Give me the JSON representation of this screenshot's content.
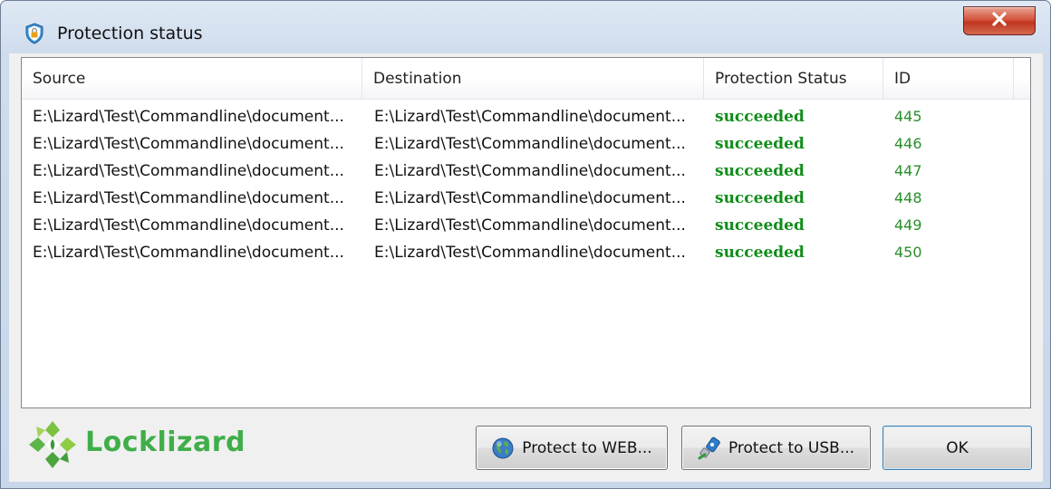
{
  "window": {
    "title": "Protection status"
  },
  "list": {
    "columns": [
      "Source",
      "Destination",
      "Protection Status",
      "ID"
    ],
    "rows": [
      {
        "source": "E:\\Lizard\\Test\\Commandline\\document...",
        "destination": "E:\\Lizard\\Test\\Commandline\\document...",
        "status": "succeeded",
        "id": "445"
      },
      {
        "source": "E:\\Lizard\\Test\\Commandline\\document...",
        "destination": "E:\\Lizard\\Test\\Commandline\\document...",
        "status": "succeeded",
        "id": "446"
      },
      {
        "source": "E:\\Lizard\\Test\\Commandline\\document...",
        "destination": "E:\\Lizard\\Test\\Commandline\\document...",
        "status": "succeeded",
        "id": "447"
      },
      {
        "source": "E:\\Lizard\\Test\\Commandline\\document...",
        "destination": "E:\\Lizard\\Test\\Commandline\\document...",
        "status": "succeeded",
        "id": "448"
      },
      {
        "source": "E:\\Lizard\\Test\\Commandline\\document...",
        "destination": "E:\\Lizard\\Test\\Commandline\\document...",
        "status": "succeeded",
        "id": "449"
      },
      {
        "source": "E:\\Lizard\\Test\\Commandline\\document...",
        "destination": "E:\\Lizard\\Test\\Commandline\\document...",
        "status": "succeeded",
        "id": "450"
      }
    ]
  },
  "logo": {
    "text": "Locklizard",
    "icon": "locklizard-logo-icon"
  },
  "buttons": {
    "web": {
      "label": "Protect to WEB...",
      "icon": "globe-icon"
    },
    "usb": {
      "label": "Protect to USB...",
      "icon": "usb-icon"
    },
    "ok": {
      "label": "OK"
    }
  },
  "colors": {
    "status_success": "#118d1a",
    "id_text": "#2a8f2a",
    "brand": "#3fae49",
    "close_button": "#c7432b"
  },
  "icons": {
    "title": "shield-lock-icon",
    "close": "close-icon"
  }
}
